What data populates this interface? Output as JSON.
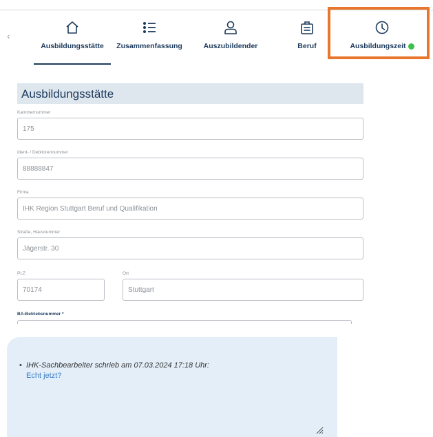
{
  "nav": {
    "tabs": [
      {
        "label": "Ausbildungsstätte",
        "icon": "home-icon",
        "active": true
      },
      {
        "label": "Zusammenfassung",
        "icon": "list-icon",
        "active": false
      },
      {
        "label": "Auszubildender",
        "icon": "person-icon",
        "active": false
      },
      {
        "label": "Beruf",
        "icon": "briefcase-icon",
        "active": false
      },
      {
        "label": "Ausbildungszeit",
        "icon": "clock-icon",
        "active": false,
        "status": "complete"
      }
    ],
    "prev_icon": "‹"
  },
  "colors": {
    "accent": "#1d3a5c",
    "highlight": "#e8762c",
    "status_ok": "#3cc04a",
    "section_bg": "#dee6ee",
    "comment_bg": "#e3eef8",
    "link": "#3a7ec6"
  },
  "form": {
    "title": "Ausbildungsstätte",
    "fields": {
      "kammernummer": {
        "label": "Kammernummer",
        "value": "175"
      },
      "ident": {
        "label": "Ident- / Debitorennummer",
        "value": "88888847"
      },
      "firma": {
        "label": "Firma",
        "value": "IHK Region Stuttgart Beruf und Qualifikation"
      },
      "strasse": {
        "label": "Straße, Hausnummer",
        "value": "Jägerstr. 30"
      },
      "plz": {
        "label": "PLZ",
        "value": "70174"
      },
      "ort": {
        "label": "Ort",
        "value": "Stuttgart"
      },
      "ba": {
        "label": "BA-Betriebsnummer *"
      }
    }
  },
  "comment": {
    "author_line": "IHK-Sachbearbeiter schrieb am 07.03.2024 17:18 Uhr:",
    "text": "Echt jetzt?"
  }
}
